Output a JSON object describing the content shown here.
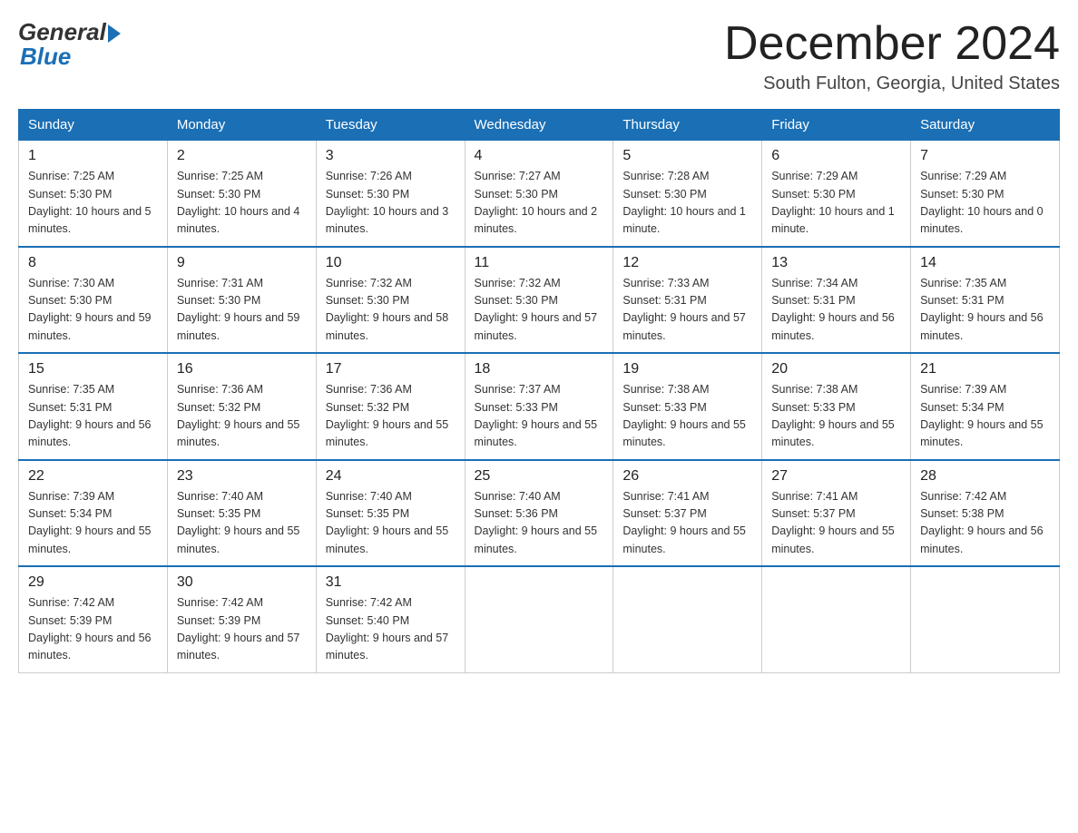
{
  "logo": {
    "general": "General",
    "blue": "Blue"
  },
  "header": {
    "month": "December 2024",
    "location": "South Fulton, Georgia, United States"
  },
  "weekdays": [
    "Sunday",
    "Monday",
    "Tuesday",
    "Wednesday",
    "Thursday",
    "Friday",
    "Saturday"
  ],
  "weeks": [
    [
      {
        "day": "1",
        "sunrise": "7:25 AM",
        "sunset": "5:30 PM",
        "daylight": "10 hours and 5 minutes."
      },
      {
        "day": "2",
        "sunrise": "7:25 AM",
        "sunset": "5:30 PM",
        "daylight": "10 hours and 4 minutes."
      },
      {
        "day": "3",
        "sunrise": "7:26 AM",
        "sunset": "5:30 PM",
        "daylight": "10 hours and 3 minutes."
      },
      {
        "day": "4",
        "sunrise": "7:27 AM",
        "sunset": "5:30 PM",
        "daylight": "10 hours and 2 minutes."
      },
      {
        "day": "5",
        "sunrise": "7:28 AM",
        "sunset": "5:30 PM",
        "daylight": "10 hours and 1 minute."
      },
      {
        "day": "6",
        "sunrise": "7:29 AM",
        "sunset": "5:30 PM",
        "daylight": "10 hours and 1 minute."
      },
      {
        "day": "7",
        "sunrise": "7:29 AM",
        "sunset": "5:30 PM",
        "daylight": "10 hours and 0 minutes."
      }
    ],
    [
      {
        "day": "8",
        "sunrise": "7:30 AM",
        "sunset": "5:30 PM",
        "daylight": "9 hours and 59 minutes."
      },
      {
        "day": "9",
        "sunrise": "7:31 AM",
        "sunset": "5:30 PM",
        "daylight": "9 hours and 59 minutes."
      },
      {
        "day": "10",
        "sunrise": "7:32 AM",
        "sunset": "5:30 PM",
        "daylight": "9 hours and 58 minutes."
      },
      {
        "day": "11",
        "sunrise": "7:32 AM",
        "sunset": "5:30 PM",
        "daylight": "9 hours and 57 minutes."
      },
      {
        "day": "12",
        "sunrise": "7:33 AM",
        "sunset": "5:31 PM",
        "daylight": "9 hours and 57 minutes."
      },
      {
        "day": "13",
        "sunrise": "7:34 AM",
        "sunset": "5:31 PM",
        "daylight": "9 hours and 56 minutes."
      },
      {
        "day": "14",
        "sunrise": "7:35 AM",
        "sunset": "5:31 PM",
        "daylight": "9 hours and 56 minutes."
      }
    ],
    [
      {
        "day": "15",
        "sunrise": "7:35 AM",
        "sunset": "5:31 PM",
        "daylight": "9 hours and 56 minutes."
      },
      {
        "day": "16",
        "sunrise": "7:36 AM",
        "sunset": "5:32 PM",
        "daylight": "9 hours and 55 minutes."
      },
      {
        "day": "17",
        "sunrise": "7:36 AM",
        "sunset": "5:32 PM",
        "daylight": "9 hours and 55 minutes."
      },
      {
        "day": "18",
        "sunrise": "7:37 AM",
        "sunset": "5:33 PM",
        "daylight": "9 hours and 55 minutes."
      },
      {
        "day": "19",
        "sunrise": "7:38 AM",
        "sunset": "5:33 PM",
        "daylight": "9 hours and 55 minutes."
      },
      {
        "day": "20",
        "sunrise": "7:38 AM",
        "sunset": "5:33 PM",
        "daylight": "9 hours and 55 minutes."
      },
      {
        "day": "21",
        "sunrise": "7:39 AM",
        "sunset": "5:34 PM",
        "daylight": "9 hours and 55 minutes."
      }
    ],
    [
      {
        "day": "22",
        "sunrise": "7:39 AM",
        "sunset": "5:34 PM",
        "daylight": "9 hours and 55 minutes."
      },
      {
        "day": "23",
        "sunrise": "7:40 AM",
        "sunset": "5:35 PM",
        "daylight": "9 hours and 55 minutes."
      },
      {
        "day": "24",
        "sunrise": "7:40 AM",
        "sunset": "5:35 PM",
        "daylight": "9 hours and 55 minutes."
      },
      {
        "day": "25",
        "sunrise": "7:40 AM",
        "sunset": "5:36 PM",
        "daylight": "9 hours and 55 minutes."
      },
      {
        "day": "26",
        "sunrise": "7:41 AM",
        "sunset": "5:37 PM",
        "daylight": "9 hours and 55 minutes."
      },
      {
        "day": "27",
        "sunrise": "7:41 AM",
        "sunset": "5:37 PM",
        "daylight": "9 hours and 55 minutes."
      },
      {
        "day": "28",
        "sunrise": "7:42 AM",
        "sunset": "5:38 PM",
        "daylight": "9 hours and 56 minutes."
      }
    ],
    [
      {
        "day": "29",
        "sunrise": "7:42 AM",
        "sunset": "5:39 PM",
        "daylight": "9 hours and 56 minutes."
      },
      {
        "day": "30",
        "sunrise": "7:42 AM",
        "sunset": "5:39 PM",
        "daylight": "9 hours and 57 minutes."
      },
      {
        "day": "31",
        "sunrise": "7:42 AM",
        "sunset": "5:40 PM",
        "daylight": "9 hours and 57 minutes."
      },
      null,
      null,
      null,
      null
    ]
  ],
  "labels": {
    "sunrise": "Sunrise:",
    "sunset": "Sunset:",
    "daylight": "Daylight:"
  }
}
